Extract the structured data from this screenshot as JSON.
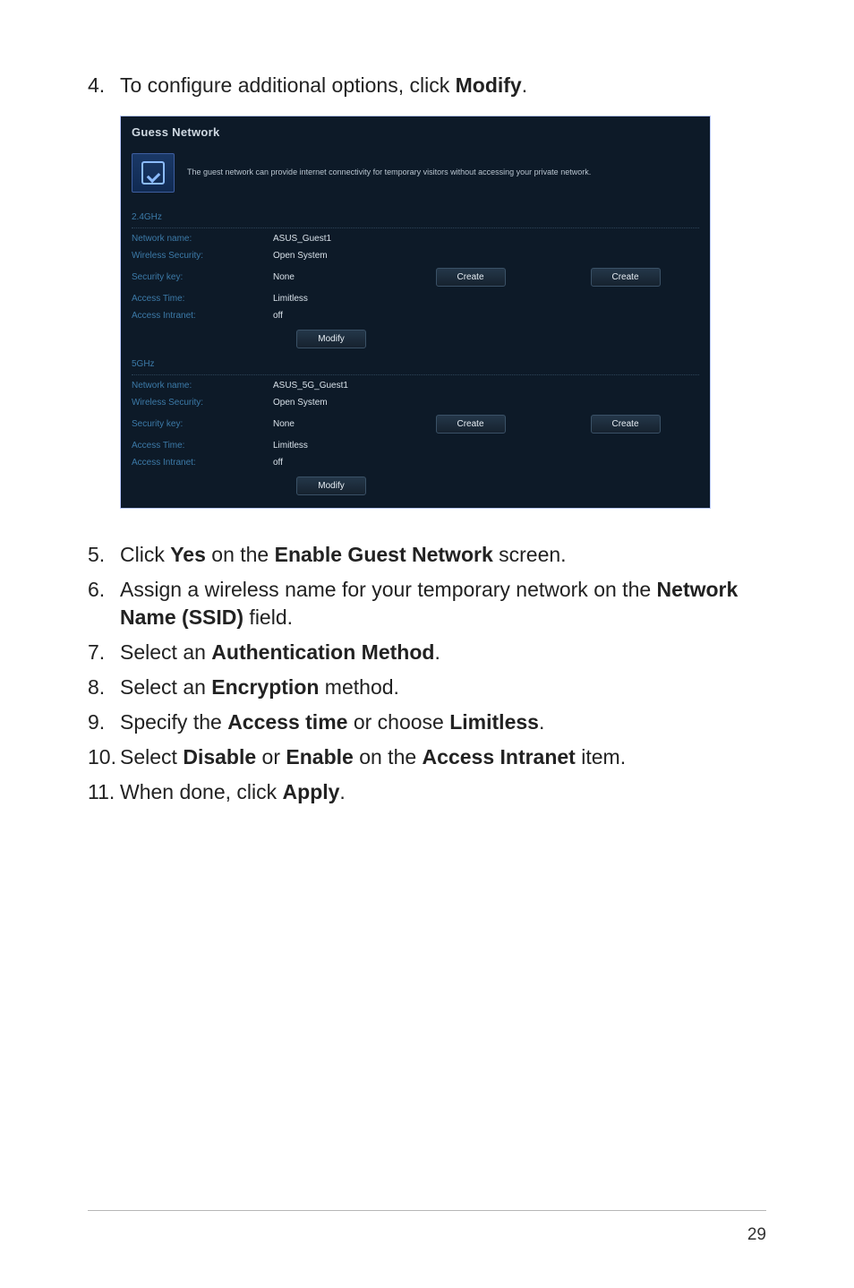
{
  "steps": {
    "s4": {
      "num": "4.",
      "text_a": "To configure additional options, click ",
      "text_b": "Modify",
      "text_c": "."
    },
    "s5": {
      "num": "5.",
      "text_a": "Click ",
      "text_b": "Yes",
      "text_c": " on the ",
      "text_d": "Enable Guest Network",
      "text_e": " screen."
    },
    "s6": {
      "num": "6.",
      "text_a": "Assign a wireless name for your temporary network on the ",
      "text_b": "Network Name (SSID)",
      "text_c": " field."
    },
    "s7": {
      "num": "7.",
      "text_a": "Select an ",
      "text_b": "Authentication Method",
      "text_c": "."
    },
    "s8": {
      "num": "8.",
      "text_a": "Select an ",
      "text_b": "Encryption",
      "text_c": " method."
    },
    "s9": {
      "num": "9.",
      "text_a": "Specify the ",
      "text_b": "Access time",
      "text_c": " or choose ",
      "text_d": "Limitless",
      "text_e": "."
    },
    "s10": {
      "num": "10.",
      "text_a": "Select ",
      "text_b": "Disable",
      "text_c": " or ",
      "text_d": "Enable",
      "text_e": " on the ",
      "text_f": "Access Intranet",
      "text_g": " item."
    },
    "s11": {
      "num": "11.",
      "text_a": "When done, click ",
      "text_b": "Apply",
      "text_c": "."
    }
  },
  "panel": {
    "title": "Guess Network",
    "description": "The guest network can provide internet connectivity for temporary visitors without accessing your private network.",
    "band24": {
      "label": "2.4GHz",
      "network_name_lbl": "Network name:",
      "network_name_val": "ASUS_Guest1",
      "wireless_security_lbl": "Wireless Security:",
      "wireless_security_val": "Open System",
      "security_key_lbl": "Security key:",
      "security_key_val": "None",
      "create1": "Create",
      "create2": "Create",
      "access_time_lbl": "Access Time:",
      "access_time_val": "Limitless",
      "access_intranet_lbl": "Access Intranet:",
      "access_intranet_val": "off",
      "modify": "Modify"
    },
    "band5": {
      "label": "5GHz",
      "network_name_lbl": "Network name:",
      "network_name_val": "ASUS_5G_Guest1",
      "wireless_security_lbl": "Wireless Security:",
      "wireless_security_val": "Open System",
      "security_key_lbl": "Security key:",
      "security_key_val": "None",
      "create1": "Create",
      "create2": "Create",
      "access_time_lbl": "Access Time:",
      "access_time_val": "Limitless",
      "access_intranet_lbl": "Access Intranet:",
      "access_intranet_val": "off",
      "modify": "Modify"
    }
  },
  "page_number": "29"
}
